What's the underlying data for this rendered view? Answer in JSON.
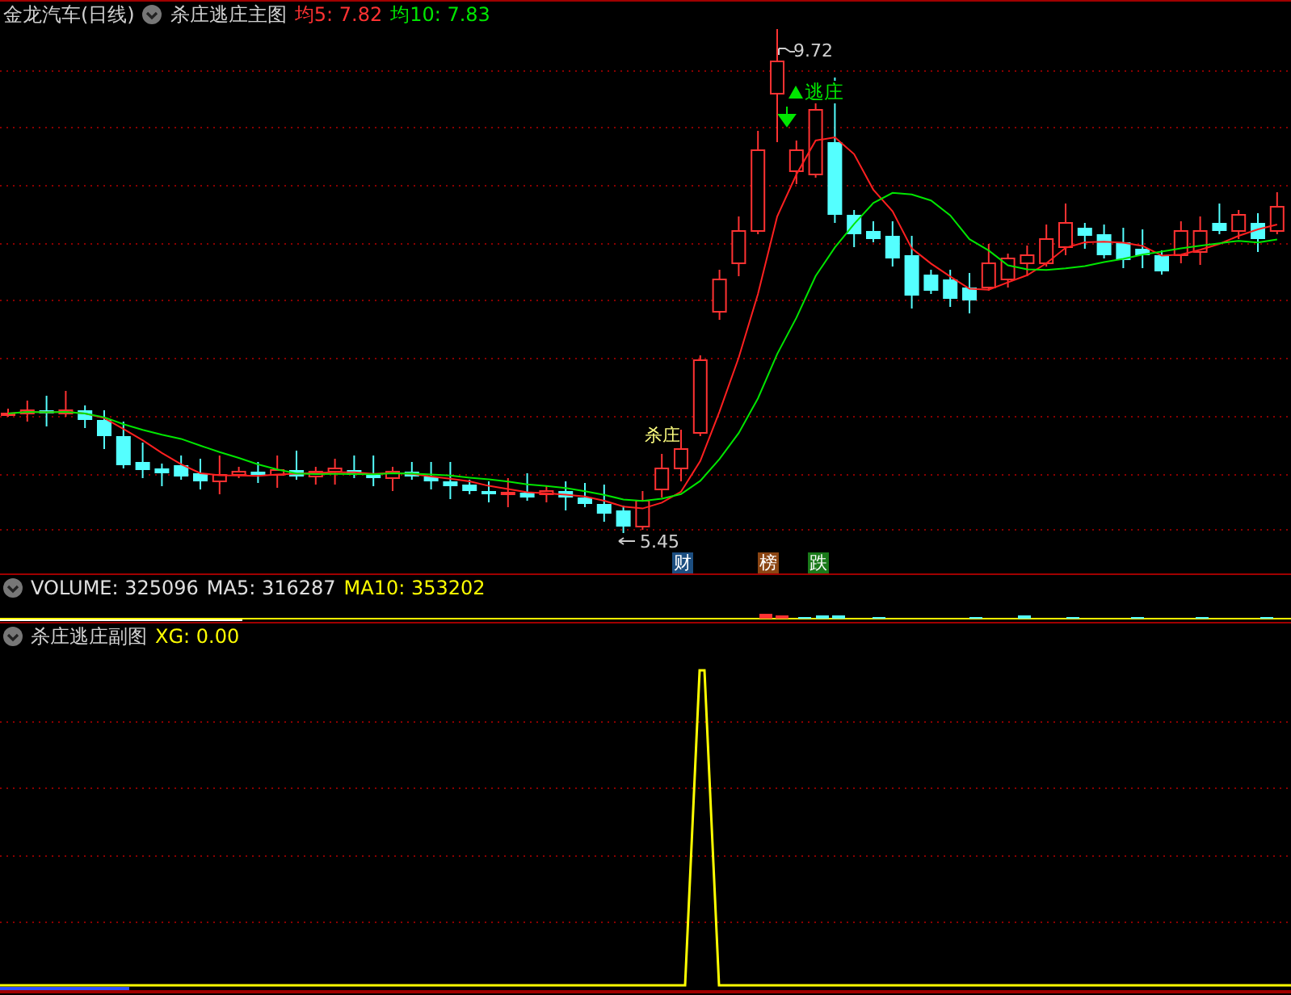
{
  "main_panel": {
    "symbol": "金龙汽车(日线)",
    "indicator": "杀庄逃庄主图",
    "ma_readings": [
      {
        "label": "均5: 7.82",
        "color": "#ff3232"
      },
      {
        "label": "均10: 7.83",
        "color": "#00e600"
      }
    ],
    "high_label": "9.72",
    "low_label": "5.45",
    "signals": [
      {
        "kind": "buy",
        "text": "杀庄"
      },
      {
        "kind": "sell",
        "text": "逃庄"
      }
    ],
    "markers": [
      {
        "text": "财",
        "color": "#1c4e80"
      },
      {
        "text": "榜",
        "color": "#8b4513"
      },
      {
        "text": "跌",
        "color": "#1a7a1a"
      }
    ]
  },
  "volume_panel": {
    "readings": [
      {
        "label": "VOLUME: 325096",
        "color": "#e0e0e0"
      },
      {
        "label": "MA5: 316287",
        "color": "#e0e0e0"
      },
      {
        "label": "MA10: 353202",
        "color": "#ffff00"
      }
    ]
  },
  "sub_panel": {
    "indicator": "杀庄逃庄副图",
    "reading": "XG: 0.00"
  }
}
